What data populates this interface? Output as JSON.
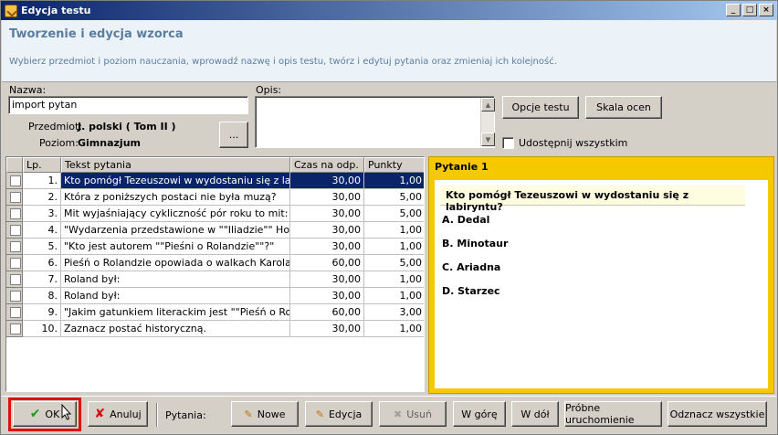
{
  "window": {
    "title": "Edycja testu",
    "minimize": "_",
    "maximize": "□",
    "close": "×"
  },
  "header": {
    "title": "Tworzenie i edycja wzorca",
    "description": "Wybierz przedmiot i poziom nauczania, wprowadź nazwę i opis testu, twórz i edytuj pytania oraz zmieniaj ich kolejność."
  },
  "form": {
    "name_label": "Nazwa:",
    "name_value": "import pytan",
    "desc_label": "Opis:",
    "desc_value": "",
    "subject_label": "Przedmiot:",
    "subject_value": "J. polski   ( Tom II )",
    "level_label": "Poziom:",
    "level_value": "Gimnazjum",
    "browse_label": "...",
    "options_btn": "Opcje testu",
    "scale_btn": "Skala ocen",
    "share_label": "Udostępnij wszystkim"
  },
  "grid": {
    "columns": [
      "",
      "Lp.",
      "Tekst pytania",
      "Czas na odp.",
      "Punkty"
    ],
    "rows": [
      {
        "lp": "1.",
        "text": "Kto pomógł Tezeuszowi w wydostaniu się z labiryntu?",
        "time": "30,00",
        "points": "1,00"
      },
      {
        "lp": "2.",
        "text": "Która z poniższych postaci nie była muzą?",
        "time": "30,00",
        "points": "5,00"
      },
      {
        "lp": "3.",
        "text": "Mit wyjaśniający cykliczność pór roku to mit:",
        "time": "30,00",
        "points": "5,00"
      },
      {
        "lp": "4.",
        "text": "\"Wydarzenia przedstawione w \"\"Iliadzie\"\" Homera miały",
        "time": "30,00",
        "points": "1,00"
      },
      {
        "lp": "5.",
        "text": "\"Kto jest autorem \"\"Pieśni o Rolandzie\"\"?\"",
        "time": "30,00",
        "points": "1,00"
      },
      {
        "lp": "6.",
        "text": "Pieśń o Rolandzie opowiada o walkach Karola Wielkiego",
        "time": "60,00",
        "points": "5,00"
      },
      {
        "lp": "7.",
        "text": "Roland był:",
        "time": "30,00",
        "points": "1,00"
      },
      {
        "lp": "8.",
        "text": "Roland był:",
        "time": "30,00",
        "points": "1,00"
      },
      {
        "lp": "9.",
        "text": "\"Jakim gatunkiem literackim jest \"\"Pieśń o Rolandzie\"\"",
        "time": "60,00",
        "points": "3,00"
      },
      {
        "lp": "10.",
        "text": "Zaznacz postać historyczną.",
        "time": "30,00",
        "points": "1,00"
      }
    ]
  },
  "preview": {
    "title": "Pytanie 1",
    "question": "Kto pomógł Tezeuszowi w wydostaniu się z labiryntu?",
    "answers": [
      "A. Dedal",
      "B. Minotaur",
      "C. Ariadna",
      "D. Starzec"
    ]
  },
  "bottom": {
    "ok": "OK",
    "cancel": "Anuluj",
    "questions_label": "Pytania:",
    "new": "Nowe",
    "edit": "Edycja",
    "delete": "Usuń",
    "up": "W górę",
    "down": "W dół",
    "trial": "Próbne uruchomienie",
    "unmark": "Odznacz wszystkie"
  }
}
